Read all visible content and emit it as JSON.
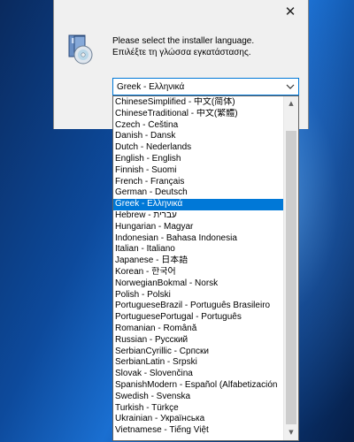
{
  "dialog": {
    "close_glyph": "✕",
    "prompt_line1": "Please select the installer language.",
    "prompt_line2": "Επιλέξτε τη γλώσσα εγκατάστασης.",
    "icon": "installer-disk-icon"
  },
  "combo": {
    "selected_value": "Greek - Ελληνικά",
    "arrow_icon": "chevron-down-icon"
  },
  "languages": [
    "ChineseSimplified - 中文(简体)",
    "ChineseTraditional - 中文(繁體)",
    "Czech - Čeština",
    "Danish - Dansk",
    "Dutch - Nederlands",
    "English - English",
    "Finnish - Suomi",
    "French - Français",
    "German - Deutsch",
    "Greek - Ελληνικά",
    "Hebrew - עברית",
    "Hungarian - Magyar",
    "Indonesian - Bahasa Indonesia",
    "Italian - Italiano",
    "Japanese - 日本語",
    "Korean - 한국어",
    "NorwegianBokmal - Norsk",
    "Polish - Polski",
    "PortugueseBrazil - Português Brasileiro",
    "PortuguesePortugal - Português",
    "Romanian - Română",
    "Russian - Русский",
    "SerbianCyrillic - Српски",
    "SerbianLatin - Srpski",
    "Slovak - Slovenčina",
    "SpanishModern - Español (Alfabetización",
    "Swedish - Svenska",
    "Turkish - Türkçe",
    "Ukrainian - Українська",
    "Vietnamese - Tiếng Việt"
  ],
  "selected_index": 9,
  "scrollbar": {
    "up_glyph": "▲",
    "down_glyph": "▼"
  },
  "colors": {
    "selection": "#0078d7",
    "combo_border": "#0078d7",
    "dialog_bg": "#f0f0f0"
  }
}
